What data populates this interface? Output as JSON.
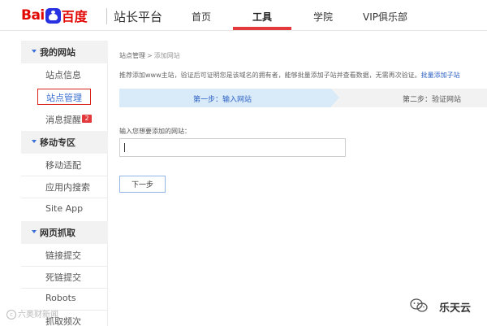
{
  "header": {
    "logo_bai": "Bai",
    "logo_cn": "百度",
    "site_title": "站长平台",
    "nav": {
      "home": "首页",
      "tools": "工具",
      "academy": "学院",
      "vip": "VIP俱乐部"
    }
  },
  "sidebar": {
    "group_my_sites": "我的网站",
    "site_info": "站点信息",
    "site_manage": "站点管理",
    "msg_remind": "消息提醒",
    "msg_badge": "2",
    "group_mobile": "移动专区",
    "mobile_adapt": "移动适配",
    "app_search": "应用内搜索",
    "site_app": "Site App",
    "group_crawl": "网页抓取",
    "link_submit": "链接提交",
    "dead_link": "死链提交",
    "robots": "Robots",
    "crawl_freq": "抓取频次"
  },
  "main": {
    "breadcrumb": {
      "parent": "站点管理",
      "sep": ">",
      "current": "添加网站"
    },
    "hint_text": "推荐添加www主站，验证后可证明您是该域名的拥有者，能够批量添加子站并查看数据，无需再次验证。",
    "hint_link": "批量添加子站",
    "step1": "第一步：输入网站",
    "step2": "第二步：验证网站",
    "field_label": "输入您想要添加的网站：",
    "input_value": "",
    "next_button": "下一步"
  },
  "watermark": {
    "left": "六奥财新闻",
    "right": "乐天云"
  },
  "colors": {
    "brand_red": "#e10601",
    "brand_blue": "#2932e1",
    "nav_active": "#e4393c",
    "link": "#2f62c4",
    "step_active_bg": "#d9ebf9"
  }
}
